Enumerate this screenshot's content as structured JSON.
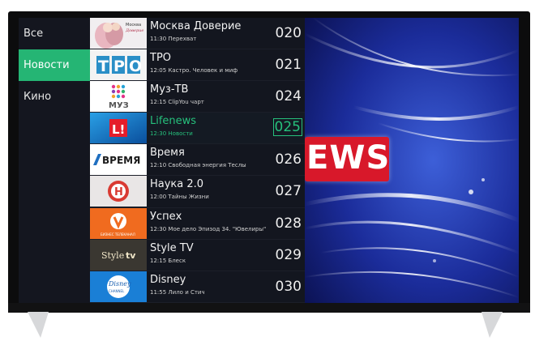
{
  "categories": [
    {
      "label": "Все",
      "active": false
    },
    {
      "label": "Новости",
      "active": true
    },
    {
      "label": "Кино",
      "active": false
    }
  ],
  "channels": [
    {
      "name": "Москва Доверие",
      "program": "11:30 Перехват",
      "number": "020",
      "logo_text": "Москва Доверие",
      "selected": false
    },
    {
      "name": "ТРО",
      "program": "12:05 Кастро. Человек и миф",
      "number": "021",
      "logo_text": "ТРО",
      "selected": false
    },
    {
      "name": "Муз-ТВ",
      "program": "12:15 ClipYou чарт",
      "number": "024",
      "logo_text": "МУЗ",
      "selected": false
    },
    {
      "name": "Lifenews",
      "program": "12:30 Новости",
      "number": "025",
      "logo_text": "L!",
      "selected": true
    },
    {
      "name": "Время",
      "program": "12:10 Свободная энергия Теслы",
      "number": "026",
      "logo_text": "ВРЕМЯ",
      "selected": false
    },
    {
      "name": "Наука 2.0",
      "program": "12:00 Тайны Жизни",
      "number": "027",
      "logo_text": "Н",
      "selected": false
    },
    {
      "name": "Успех",
      "program": "12:30 Мое дело Эпизод 34. \"Ювелиры\"",
      "number": "028",
      "logo_text": "БИЗНЕС ТЕЛЕКАНАЛ",
      "selected": false
    },
    {
      "name": "Style TV",
      "program": "12:15 Блеск",
      "number": "029",
      "logo_text": "Styletv",
      "selected": false
    },
    {
      "name": "Disney",
      "program": "11:55 Лило и Стич",
      "number": "030",
      "logo_text": "Disney CHANNEL",
      "selected": false
    }
  ],
  "preview": {
    "headline_fragment": "EWS"
  },
  "colors": {
    "accent": "#25b574",
    "selected_text": "#26c07c",
    "panel": "#13161f",
    "news_red": "#d8182a"
  }
}
